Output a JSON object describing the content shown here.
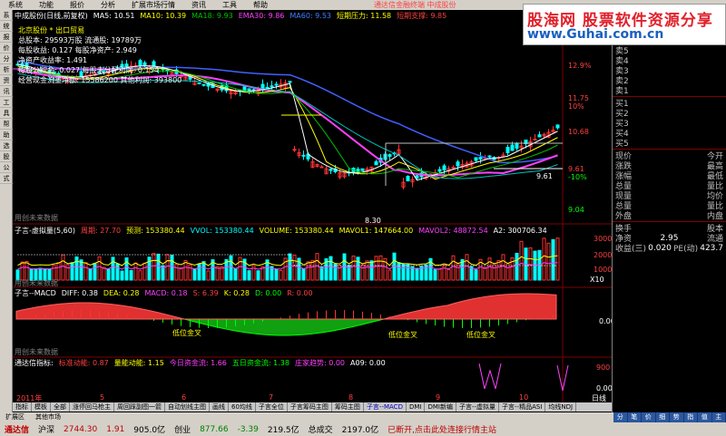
{
  "menu": {
    "items": [
      "系统",
      "功能",
      "报价",
      "分析",
      "扩展市场行情",
      "资讯",
      "工具",
      "帮助"
    ],
    "brand_text": "通达信金融终端   中成股份"
  },
  "logo": {
    "cn": "股海网  股票软件资源分享",
    "en": "www.Guhai.com.cn"
  },
  "main": {
    "title": "中成股份(日线,前复权)",
    "ma5_label": "MA5: 10.51",
    "ma10_label": "MA10: 10.39",
    "ma18_label": "MA18: 9.93",
    "ema30_label": "EMA30: 9.86",
    "ma60_label": "MA60: 9.53",
    "short_pressure": "短期压力: 11.58",
    "short_support": "短期支撑: 9.85",
    "info": [
      "北京股份 * 出口贸易",
      "总股本: 29593万股  流通股: 19789万",
      "每股收益: 0.127  每股净资产: 2.949",
      "净资产收益率: 1.491",
      "每股公积金: 0.027  每股未分配利润: 0.154",
      "经营现金流量净额: 15586200  其他利润: 393800"
    ],
    "price_axis": [
      "11.75",
      "12.9%",
      "10%",
      "10.68",
      "9.61",
      "-10%",
      "9.04"
    ],
    "low_marker": "8.30",
    "marker_mid": "9.61",
    "bottom_note": "用创未来数据"
  },
  "volume_panel": {
    "title": "子言-虚拟量(5,60)",
    "vals": [
      "周期: 27.70",
      "预测: 153380.44",
      "VVOL: 153380.44",
      "VOLUME: 153380.44",
      "MAVOL1: 147664.00",
      "MAVOL2: 48872.54",
      "A2: 300706.34"
    ],
    "axis": [
      "30000",
      "20000",
      "10000",
      "X10"
    ],
    "note": "用创未来数据"
  },
  "macd_panel": {
    "title": "子言--MACD",
    "vals": [
      "DIFF: 0.38",
      "DEA: 0.28",
      "MACD: 0.18",
      "S: 6.39",
      "K: 0.28",
      "D: 0.00",
      "R: 0.00"
    ],
    "labels": [
      "低位金叉",
      "低位金叉",
      "低位金叉"
    ],
    "axis": [
      "0.00"
    ],
    "note": "用创未来数据"
  },
  "signal_panel": {
    "title": "通达信指标:",
    "vals": [
      "标准动能: 0.87",
      "量能动能: 1.15",
      "今日资金流: 1.66",
      "五日资金流: 1.38",
      "庄家趋势: 0.00",
      "A09: 0.00"
    ],
    "axis": [
      "900",
      "0.00"
    ],
    "dates": [
      "2011年",
      "5",
      "6",
      "7",
      "8",
      "9",
      "10",
      "日线"
    ]
  },
  "right_panel": {
    "asks": [
      "卖5",
      "卖4",
      "卖3",
      "卖2",
      "卖1"
    ],
    "bids": [
      "买1",
      "买2",
      "买3",
      "买4",
      "买5"
    ],
    "stats": [
      {
        "k": "现价",
        "v": "今开"
      },
      {
        "k": "涨跌",
        "v": "最高"
      },
      {
        "k": "涨幅",
        "v": "最低"
      },
      {
        "k": "总量",
        "v": "量比"
      },
      {
        "k": "现量",
        "v": "均价"
      },
      {
        "k": "总量",
        "v": "量比"
      },
      {
        "k": "外盘",
        "v": "内盘"
      }
    ],
    "turnover": "换手",
    "turnover_v": "股本",
    "pe": "净资",
    "pe_v": "2.95",
    "flow": "流通",
    "earn": "收益(三)",
    "earn_v": "0.020",
    "pe2": "PE(动)",
    "pe2_v": "423.7"
  },
  "indicator_tabs": [
    "指标",
    "模板",
    "全部",
    "涨停回马枪主",
    "周回踩副图一箭",
    "自动划线主图",
    "画线",
    "60均线",
    "子言全位",
    "子言筹码主图",
    "筹码主图",
    "子言--MACD",
    "DMI",
    "DMI新编",
    "子言--虚拟量",
    "子言--精品ASI",
    "均线NDJ"
  ],
  "market_tabs": [
    "扩展区",
    "其他市场"
  ],
  "buttons": [
    "分",
    "笔",
    "价",
    "细",
    "势",
    "指",
    "值",
    "主"
  ],
  "status": {
    "seg1": "通达信",
    "seg2": "沪深",
    "idx1": "2744.30",
    "chg1": "1.91",
    "amt1": "905.0亿",
    "seg3": "创业",
    "idx2": "877.66",
    "chg2": "-3.39",
    "amt2": "219.5亿",
    "seg4": "总成交",
    "amt3": "2197.0亿",
    "msg": "已断开,点击此处连接行情主站"
  },
  "colors": {
    "up": "#ff3232",
    "down": "#00ffff",
    "ma5": "#ffffff",
    "ma10": "#ffff00",
    "ma_magenta": "#ff40ff",
    "ma60": "#4060ff",
    "green": "#00ff00"
  }
}
